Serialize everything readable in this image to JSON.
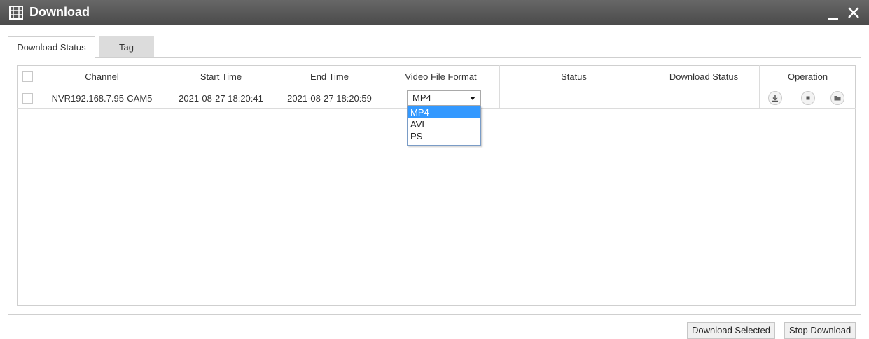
{
  "window": {
    "title": "Download",
    "title_icon": "film-icon",
    "controls": [
      "minimize-icon",
      "close-icon"
    ],
    "colors": {
      "titlebar": "#575757",
      "selected_option": "#3399ff"
    }
  },
  "tabs": [
    {
      "label": "Download Status",
      "active": true
    },
    {
      "label": "Tag",
      "active": false
    }
  ],
  "table": {
    "columns": [
      "Channel",
      "Start Time",
      "End Time",
      "Video File Format",
      "Status",
      "Download Status",
      "Operation"
    ],
    "rows": [
      {
        "checked": false,
        "channel": "NVR192.168.7.95-CAM5",
        "start_time": "2021-08-27 18:20:41",
        "end_time": "2021-08-27 18:20:59",
        "format": "MP4",
        "status": "",
        "download_status": "",
        "operations": [
          "download-icon",
          "stop-icon",
          "folder-icon"
        ]
      }
    ]
  },
  "format_dropdown": {
    "open": true,
    "selected": "MP4",
    "options": [
      "MP4",
      "AVI",
      "PS"
    ]
  },
  "buttons": {
    "download_selected": "Download Selected",
    "stop_download": "Stop Download"
  }
}
